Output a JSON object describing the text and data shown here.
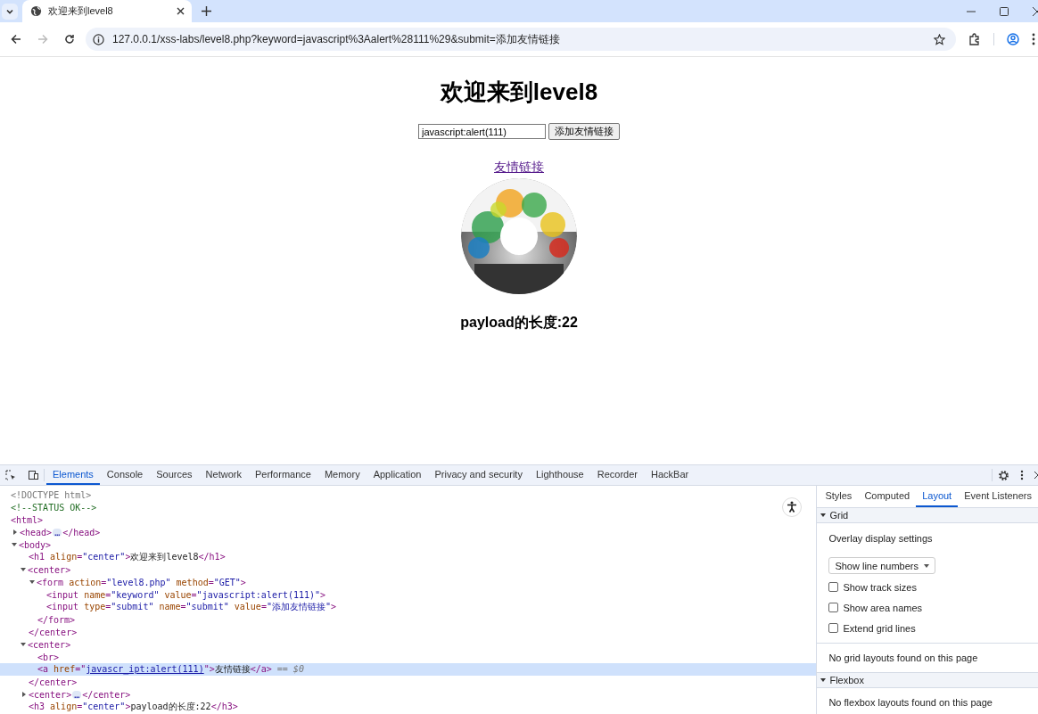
{
  "browser": {
    "tab": {
      "title": "欢迎来到level8"
    },
    "address_bar": {
      "url": "127.0.0.1/xss-labs/level8.php?keyword=javascript%3Aalert%28111%29&submit=添加友情链接"
    },
    "nav": {
      "back_disabled": false,
      "forward_disabled": true
    }
  },
  "page": {
    "heading": "欢迎来到level8",
    "keyword_field": {
      "value": "javascript:alert(111)"
    },
    "submit_button": "添加友情链接",
    "link": "友情链接",
    "payload_length": "payload的长度:22"
  },
  "devtools": {
    "tabs": [
      {
        "label": "Elements",
        "selected": true
      },
      {
        "label": "Console",
        "selected": false
      },
      {
        "label": "Sources",
        "selected": false
      },
      {
        "label": "Network",
        "selected": false
      },
      {
        "label": "Performance",
        "selected": false
      },
      {
        "label": "Memory",
        "selected": false
      },
      {
        "label": "Application",
        "selected": false
      },
      {
        "label": "Privacy and security",
        "selected": false
      },
      {
        "label": "Lighthouse",
        "selected": false
      },
      {
        "label": "Recorder",
        "selected": false
      },
      {
        "label": "HackBar",
        "selected": false
      }
    ],
    "dom_tree": [
      {
        "segs": [
          {
            "kind": "doctype",
            "text": "<!DOCTYPE html>"
          }
        ]
      },
      {
        "segs": [
          {
            "kind": "comment",
            "text": "<!--STATUS OK-->"
          }
        ]
      },
      {
        "segs": [
          {
            "kind": "tag",
            "text": "<html>"
          }
        ],
        "children": [
          {
            "expanded": false,
            "segs": [
              {
                "kind": "tag",
                "text": "<head>"
              },
              {
                "kind": "ellipsis",
                "text": "…"
              },
              {
                "kind": "tag",
                "text": "</head>"
              }
            ]
          },
          {
            "expanded": true,
            "segs": [
              {
                "kind": "tag",
                "text": "<body>"
              }
            ],
            "children": [
              {
                "segs": [
                  {
                    "kind": "tag",
                    "text": "<h1"
                  },
                  {
                    "kind": "attr",
                    "text": " align"
                  },
                  {
                    "kind": "tag",
                    "text": "="
                  },
                  {
                    "kind": "val",
                    "text": "\"center\""
                  },
                  {
                    "kind": "tag",
                    "text": ">"
                  },
                  {
                    "kind": "text",
                    "text": "欢迎来到level8"
                  },
                  {
                    "kind": "tag",
                    "text": "</h1>"
                  }
                ]
              },
              {
                "expanded": true,
                "segs": [
                  {
                    "kind": "tag",
                    "text": "<center>"
                  }
                ],
                "close": [
                  {
                    "kind": "tag",
                    "text": "</center>"
                  }
                ],
                "children": [
                  {
                    "expanded": true,
                    "segs": [
                      {
                        "kind": "tag",
                        "text": "<form"
                      },
                      {
                        "kind": "attr",
                        "text": " action"
                      },
                      {
                        "kind": "tag",
                        "text": "="
                      },
                      {
                        "kind": "val",
                        "text": "\"level8.php\""
                      },
                      {
                        "kind": "attr",
                        "text": " method"
                      },
                      {
                        "kind": "tag",
                        "text": "="
                      },
                      {
                        "kind": "val",
                        "text": "\"GET\""
                      },
                      {
                        "kind": "tag",
                        "text": ">"
                      }
                    ],
                    "close": [
                      {
                        "kind": "tag",
                        "text": "</form>"
                      }
                    ],
                    "children": [
                      {
                        "segs": [
                          {
                            "kind": "tag",
                            "text": "<input"
                          },
                          {
                            "kind": "attr",
                            "text": " name"
                          },
                          {
                            "kind": "tag",
                            "text": "="
                          },
                          {
                            "kind": "val",
                            "text": "\"keyword\""
                          },
                          {
                            "kind": "attr",
                            "text": " value"
                          },
                          {
                            "kind": "tag",
                            "text": "="
                          },
                          {
                            "kind": "val",
                            "text": "\"javascript:alert(111)\""
                          },
                          {
                            "kind": "tag",
                            "text": ">"
                          }
                        ]
                      },
                      {
                        "segs": [
                          {
                            "kind": "tag",
                            "text": "<input"
                          },
                          {
                            "kind": "attr",
                            "text": " type"
                          },
                          {
                            "kind": "tag",
                            "text": "="
                          },
                          {
                            "kind": "val",
                            "text": "\"submit\""
                          },
                          {
                            "kind": "attr",
                            "text": " name"
                          },
                          {
                            "kind": "tag",
                            "text": "="
                          },
                          {
                            "kind": "val",
                            "text": "\"submit\""
                          },
                          {
                            "kind": "attr",
                            "text": " value"
                          },
                          {
                            "kind": "tag",
                            "text": "="
                          },
                          {
                            "kind": "val",
                            "text": "\"添加友情链接\""
                          },
                          {
                            "kind": "tag",
                            "text": ">"
                          }
                        ]
                      }
                    ]
                  }
                ]
              },
              {
                "expanded": true,
                "segs": [
                  {
                    "kind": "tag",
                    "text": "<center>"
                  }
                ],
                "close": [
                  {
                    "kind": "tag",
                    "text": "</center>"
                  }
                ],
                "children": [
                  {
                    "segs": [
                      {
                        "kind": "tag",
                        "text": "<br>"
                      }
                    ]
                  },
                  {
                    "selected": true,
                    "segs": [
                      {
                        "kind": "tag",
                        "text": "<a"
                      },
                      {
                        "kind": "attr",
                        "text": " href"
                      },
                      {
                        "kind": "tag",
                        "text": "=\""
                      },
                      {
                        "kind": "link",
                        "text": "javascr_ipt:alert(111)"
                      },
                      {
                        "kind": "tag",
                        "text": "\">"
                      },
                      {
                        "kind": "text",
                        "text": "友情链接"
                      },
                      {
                        "kind": "tag",
                        "text": "</a>"
                      },
                      {
                        "kind": "eq",
                        "text": "== $0"
                      }
                    ]
                  }
                ]
              },
              {
                "expanded": false,
                "segs": [
                  {
                    "kind": "tag",
                    "text": "<center>"
                  },
                  {
                    "kind": "ellipsis",
                    "text": "…"
                  },
                  {
                    "kind": "tag",
                    "text": "</center>"
                  }
                ]
              },
              {
                "segs": [
                  {
                    "kind": "tag",
                    "text": "<h3"
                  },
                  {
                    "kind": "attr",
                    "text": " align"
                  },
                  {
                    "kind": "tag",
                    "text": "="
                  },
                  {
                    "kind": "val",
                    "text": "\"center\""
                  },
                  {
                    "kind": "tag",
                    "text": ">"
                  },
                  {
                    "kind": "text",
                    "text": "payload的长度:22"
                  },
                  {
                    "kind": "tag",
                    "text": "</h3>"
                  }
                ]
              }
            ]
          }
        ]
      }
    ],
    "side_tabs": [
      {
        "label": "Styles",
        "selected": false
      },
      {
        "label": "Computed",
        "selected": false
      },
      {
        "label": "Layout",
        "selected": true
      },
      {
        "label": "Event Listeners",
        "selected": false
      }
    ],
    "sections": [
      {
        "title": "Grid",
        "expanded": true,
        "heading": "Overlay display settings",
        "select": "Show line numbers",
        "checkboxes": [
          {
            "label": "Show track sizes",
            "checked": false
          },
          {
            "label": "Show area names",
            "checked": false
          },
          {
            "label": "Extend grid lines",
            "checked": false
          }
        ],
        "note": "No grid layouts found on this page"
      },
      {
        "title": "Flexbox",
        "expanded": true,
        "note": "No flexbox layouts found on this page"
      }
    ]
  }
}
